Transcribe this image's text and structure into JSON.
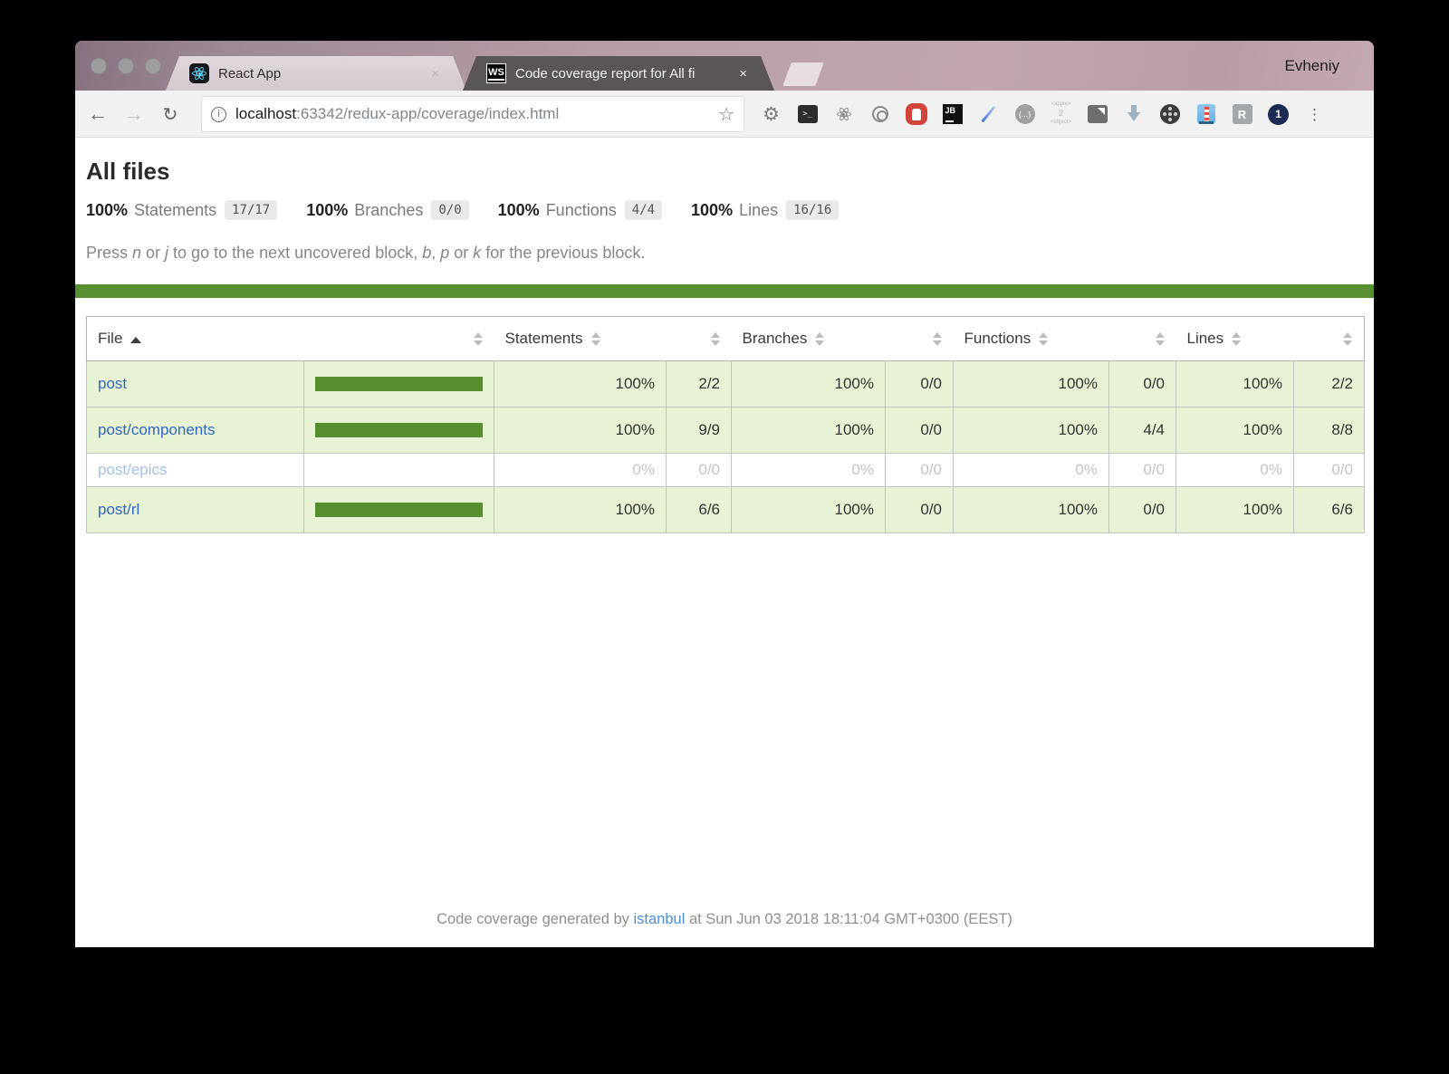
{
  "browser": {
    "profile_name": "Evheniy",
    "tabs": [
      {
        "title": "React App",
        "close_glyph": "×"
      },
      {
        "title": "Code coverage report for All fi",
        "close_glyph": "×"
      }
    ],
    "url": {
      "host": "localhost",
      "rest": ":63342/redux-app/coverage/index.html"
    },
    "icon_text": {
      "ws": "WS",
      "terminal": ">_",
      "jb": "JB",
      "braces": "{…}",
      "apple_top": "<apple>",
      "apple_mid": "2",
      "apple_bottom": "<object>",
      "r": "R",
      "one": "1",
      "gear": "⚙",
      "back": "←",
      "forward": "→",
      "reload": "↻",
      "star": "☆",
      "info": "i",
      "kebab": "⋮"
    }
  },
  "page": {
    "title": "All files",
    "summary": [
      {
        "pct": "100%",
        "label": "Statements",
        "fraction": "17/17"
      },
      {
        "pct": "100%",
        "label": "Branches",
        "fraction": "0/0"
      },
      {
        "pct": "100%",
        "label": "Functions",
        "fraction": "4/4"
      },
      {
        "pct": "100%",
        "label": "Lines",
        "fraction": "16/16"
      }
    ],
    "hint": {
      "p0": "Press ",
      "k1": "n",
      "p1": " or ",
      "k2": "j",
      "p2": " to go to the next uncovered block, ",
      "k3": "b",
      "p3": ", ",
      "k4": "p",
      "p4": " or ",
      "k5": "k",
      "p5": " for the previous block."
    },
    "table": {
      "headers": {
        "file": "File",
        "statements": "Statements",
        "branches": "Branches",
        "functions": "Functions",
        "lines": "Lines"
      },
      "rows": [
        {
          "file": "post",
          "statements_pct": "100%",
          "statements": "2/2",
          "branches_pct": "100%",
          "branches": "0/0",
          "functions_pct": "100%",
          "functions": "0/0",
          "lines_pct": "100%",
          "lines": "2/2"
        },
        {
          "file": "post/components",
          "statements_pct": "100%",
          "statements": "9/9",
          "branches_pct": "100%",
          "branches": "0/0",
          "functions_pct": "100%",
          "functions": "4/4",
          "lines_pct": "100%",
          "lines": "8/8"
        },
        {
          "file": "post/epics",
          "statements_pct": "0%",
          "statements": "0/0",
          "branches_pct": "0%",
          "branches": "0/0",
          "functions_pct": "0%",
          "functions": "0/0",
          "lines_pct": "0%",
          "lines": "0/0"
        },
        {
          "file": "post/rl",
          "statements_pct": "100%",
          "statements": "6/6",
          "branches_pct": "100%",
          "branches": "0/0",
          "functions_pct": "100%",
          "functions": "0/0",
          "lines_pct": "100%",
          "lines": "6/6"
        }
      ]
    },
    "footer": {
      "prefix": "Code coverage generated by ",
      "link": "istanbul",
      "suffix": " at Sun Jun 03 2018 18:11:04 GMT+0300 (EEST)"
    }
  },
  "colors": {
    "status_line_green": "#579032",
    "bar_fill_green": "#588d31",
    "row_high_bg": "#e7f3d4",
    "link_blue": "#3366c4",
    "link_blue_faded": "#a5c0e8",
    "titlebar_mauve": "#b69da7",
    "active_tab_gray": "#595559"
  }
}
